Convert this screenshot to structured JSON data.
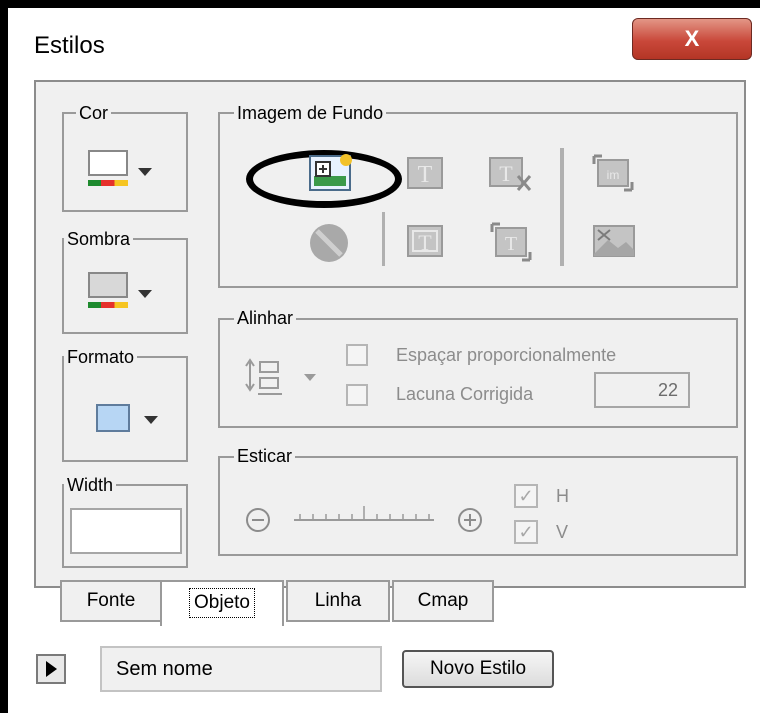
{
  "window": {
    "title": "Estilos",
    "close_label": "X"
  },
  "groups": {
    "cor": "Cor",
    "sombra": "Sombra",
    "formato": "Formato",
    "width": "Width",
    "imagem_fundo": "Imagem de Fundo",
    "alinhar": "Alinhar",
    "esticar": "Esticar"
  },
  "alinhar": {
    "espacar_label": "Espaçar proporcionalmente",
    "lacuna_label": "Lacuna Corrigida",
    "lacuna_value": "22"
  },
  "esticar": {
    "h_label": "H",
    "v_label": "V"
  },
  "tabs": [
    {
      "label": "Fonte"
    },
    {
      "label": "Objeto",
      "active": true
    },
    {
      "label": "Linha"
    },
    {
      "label": "Cmap"
    }
  ],
  "footer": {
    "style_name": "Sem nome",
    "new_style_button": "Novo Estilo"
  },
  "colors": {
    "close_red": "#c9483a",
    "panel_bg": "#f0f0f0",
    "swatch_blue": "#b7d6f4",
    "highlight_circle": "#000000"
  }
}
